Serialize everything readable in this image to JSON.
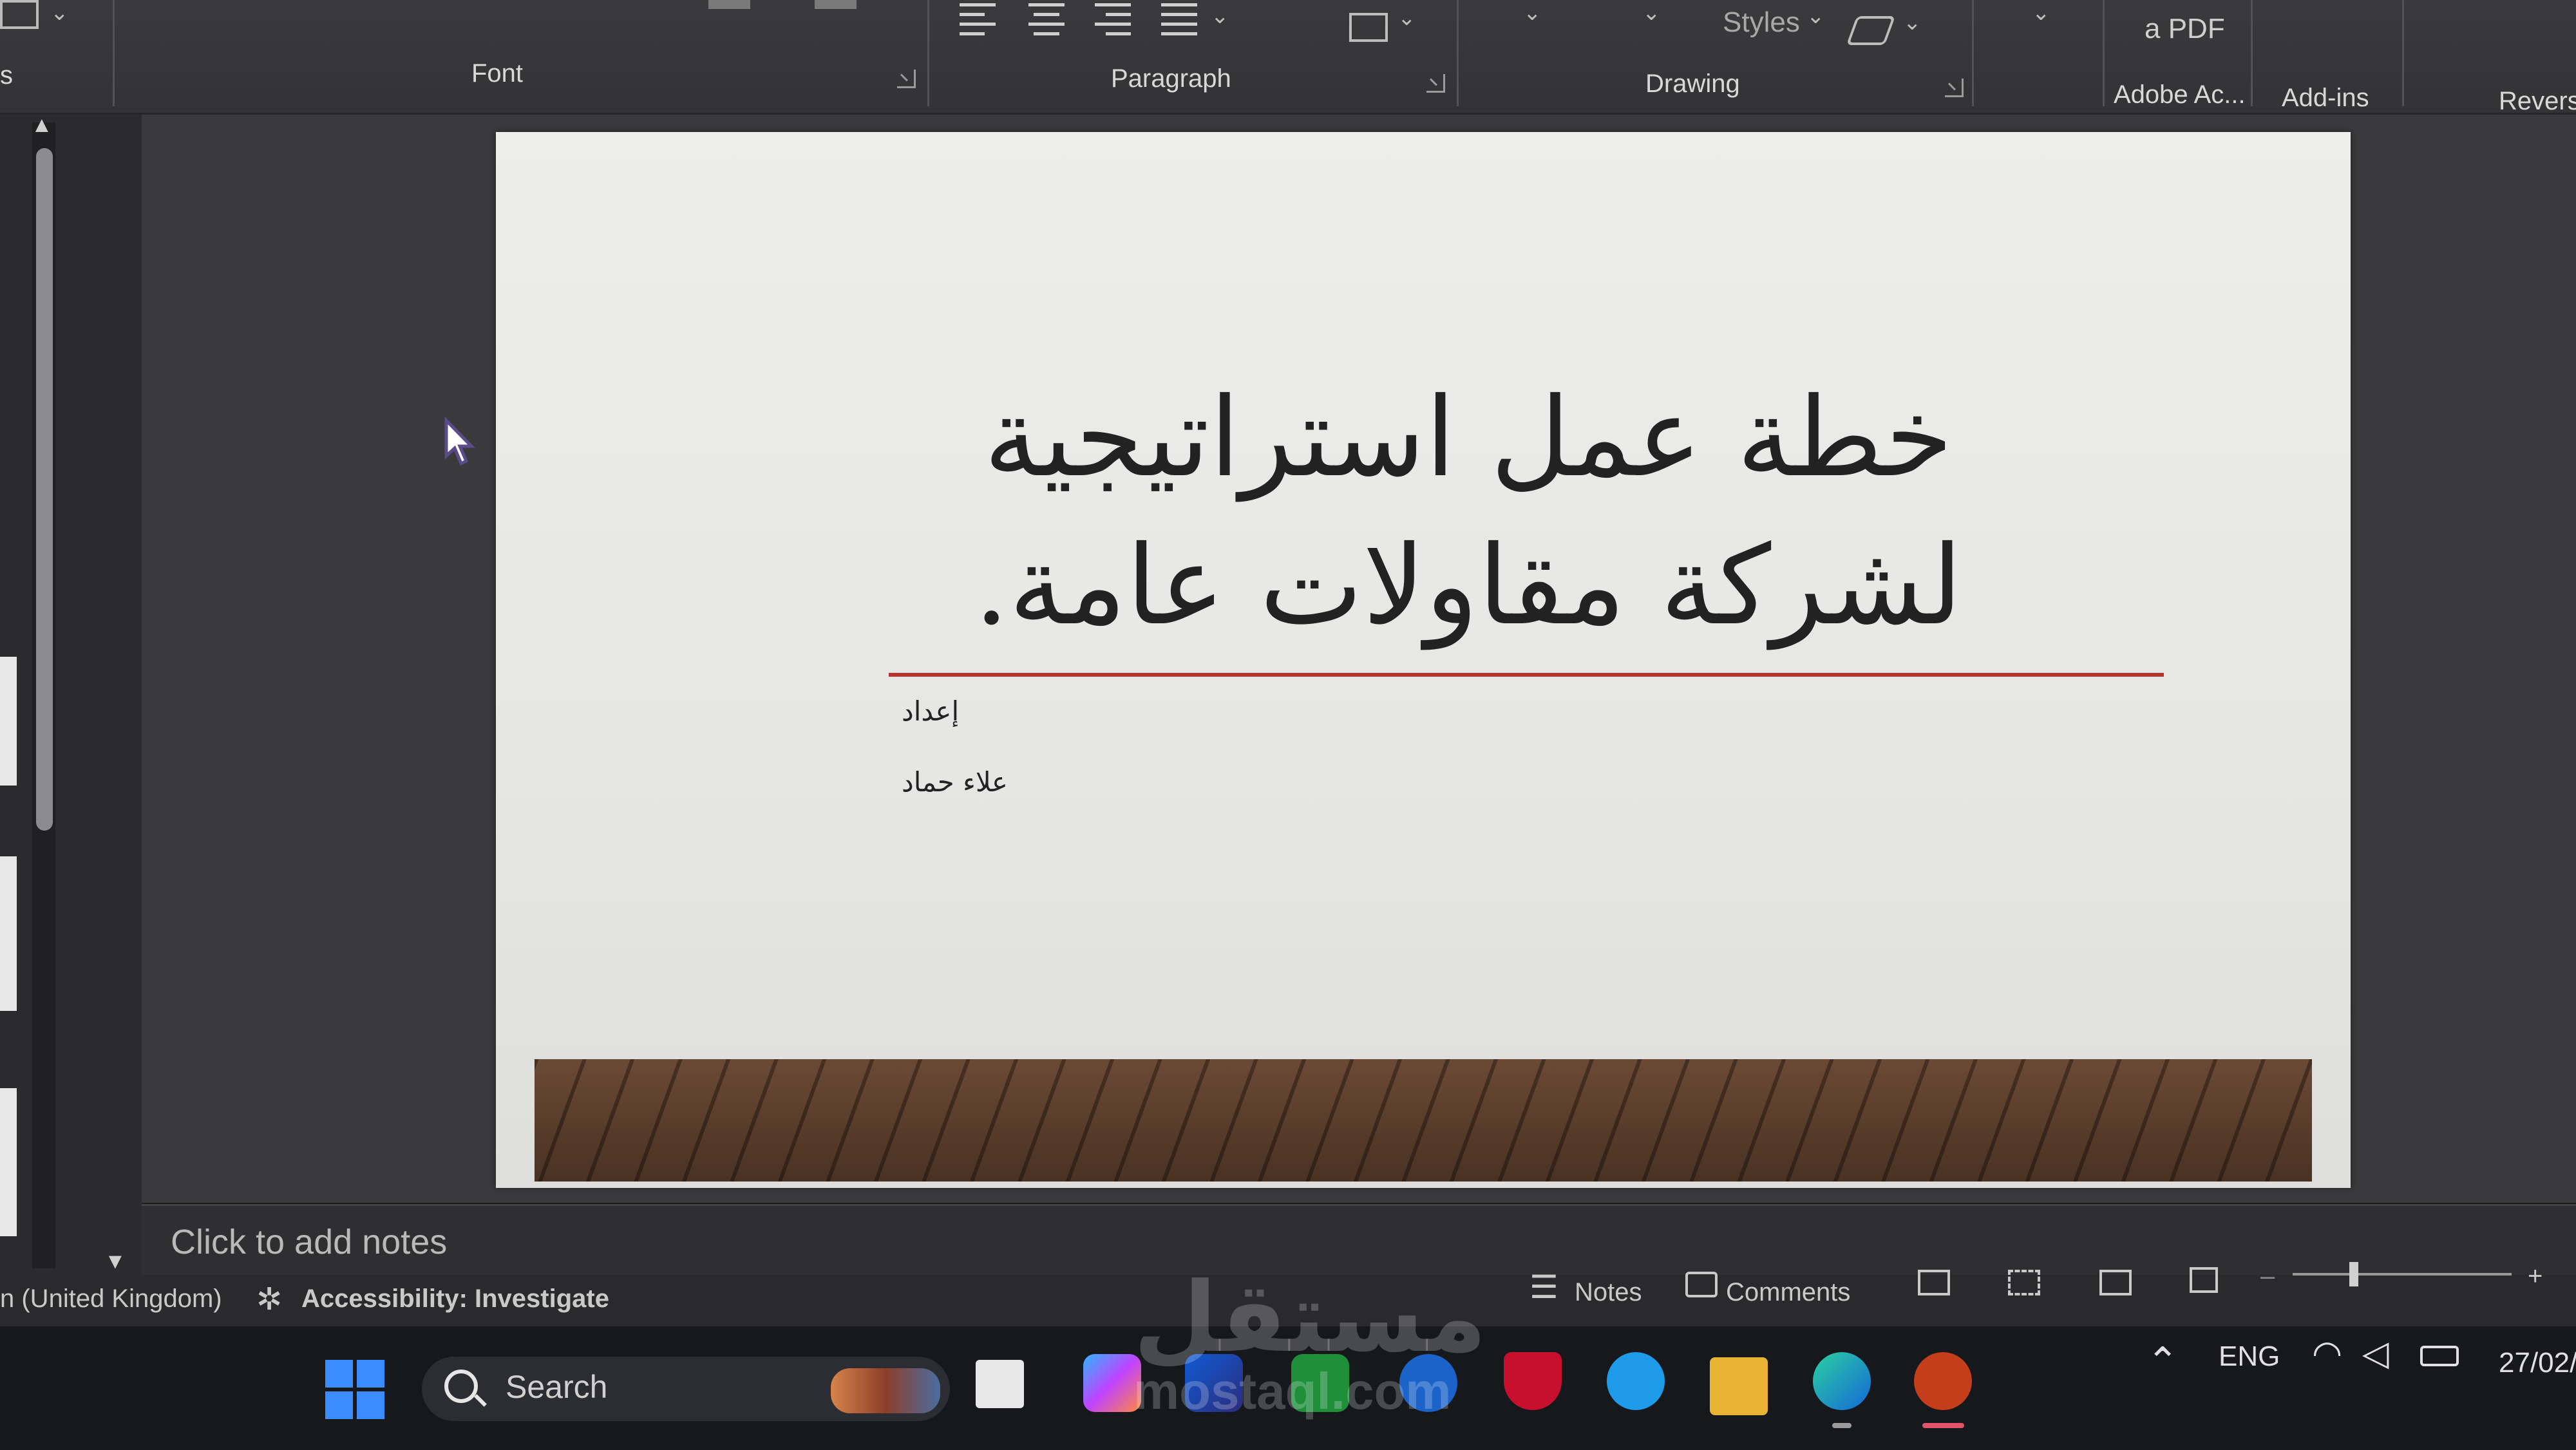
{
  "ribbon": {
    "groups": {
      "font": "Font",
      "paragraph": "Paragraph",
      "drawing": "Drawing",
      "adobe": "Adobe Ac...",
      "addins": "Add-ins",
      "reverse": "Revers",
      "left_fragment": "s"
    },
    "styles_label": "Styles",
    "pdf_label": "a PDF"
  },
  "slide": {
    "title": "خطة عمل استراتيجية لشركة مقاولات عامة.",
    "prepared_by_label": "إعداد",
    "author": "علاء حماد"
  },
  "notes": {
    "placeholder": "Click to add notes"
  },
  "status_bar": {
    "language": "n (United Kingdom)",
    "accessibility": "Accessibility: Investigate",
    "notes_button": "Notes",
    "comments_button": "Comments",
    "zoom_minus": "–",
    "zoom_plus": "+"
  },
  "taskbar": {
    "search_placeholder": "Search",
    "language": "ENG",
    "date": "27/02/"
  },
  "watermark": {
    "arabic": "مستقل",
    "latin": "mostaql.com"
  },
  "colors": {
    "title_rule": "#b8332e",
    "app_background": "#3a3a3c",
    "taskbar": "#17181c",
    "powerpoint": "#c43e1c"
  }
}
